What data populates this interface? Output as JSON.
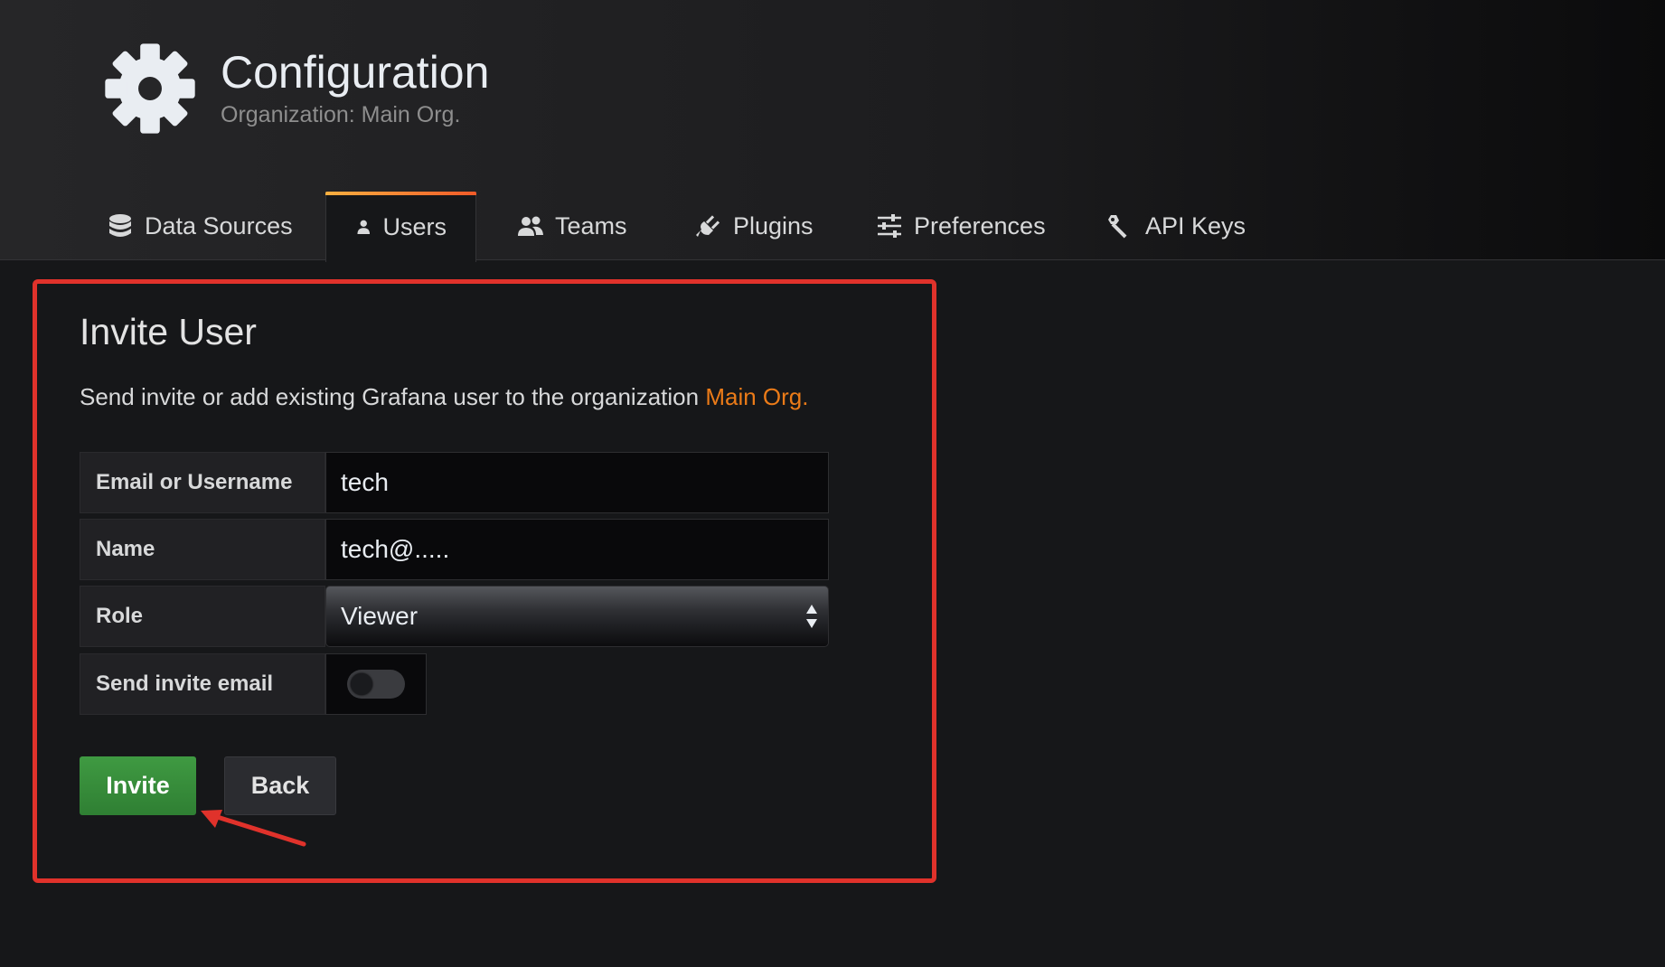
{
  "header": {
    "icon": "gear-icon",
    "title": "Configuration",
    "subtitle": "Organization: Main Org."
  },
  "tabs": [
    {
      "label": "Data Sources",
      "icon": "database-icon",
      "active": false
    },
    {
      "label": "Users",
      "icon": "user-icon",
      "active": true
    },
    {
      "label": "Teams",
      "icon": "users-icon",
      "active": false
    },
    {
      "label": "Plugins",
      "icon": "plug-icon",
      "active": false
    },
    {
      "label": "Preferences",
      "icon": "sliders-icon",
      "active": false
    },
    {
      "label": "API Keys",
      "icon": "key-icon",
      "active": false
    }
  ],
  "page": {
    "title": "Invite User",
    "description": "Send invite or add existing Grafana user to the organization ",
    "org_name": "Main Org."
  },
  "form": {
    "email_label": "Email or Username",
    "email_value": "tech",
    "name_label": "Name",
    "name_value": "tech@.....",
    "role_label": "Role",
    "role_value": "Viewer",
    "send_invite_label": "Send invite email",
    "send_invite_enabled": false
  },
  "buttons": {
    "invite": "Invite",
    "back": "Back"
  },
  "colors": {
    "accent_orange": "#eb7b18",
    "success_green": "#3f9a42",
    "annotation_red": "#e0322b"
  }
}
